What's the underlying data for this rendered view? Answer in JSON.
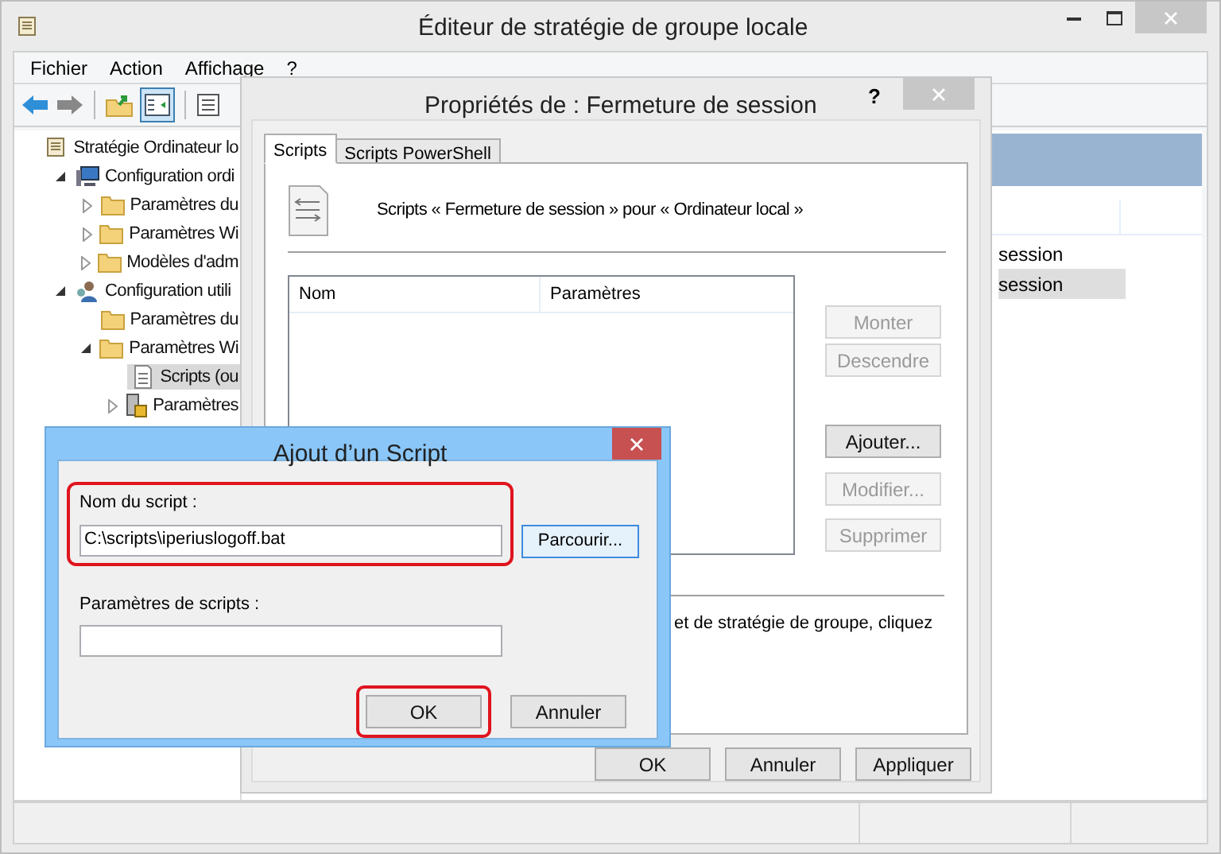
{
  "window": {
    "title": "Éditeur de stratégie de groupe locale"
  },
  "menu": [
    "Fichier",
    "Action",
    "Affichage",
    "?"
  ],
  "tree": [
    {
      "label": "Stratégie Ordinateur lo",
      "kind": "policy",
      "selected": false,
      "children": [
        {
          "label": "Configuration ordi",
          "kind": "computer",
          "expanded": true,
          "selected": false,
          "children": [
            {
              "label": "Paramètres du",
              "kind": "folder",
              "expanded": false,
              "selected": false
            },
            {
              "label": "Paramètres Wi",
              "kind": "folder",
              "expanded": false,
              "selected": false
            },
            {
              "label": "Modèles d'adm",
              "kind": "folder",
              "expanded": false,
              "selected": false
            }
          ]
        },
        {
          "label": "Configuration utili",
          "kind": "user",
          "expanded": true,
          "selected": false,
          "children": [
            {
              "label": "Paramètres du",
              "kind": "folder",
              "selected": false
            },
            {
              "label": "Paramètres Wi",
              "kind": "folder",
              "expanded": true,
              "selected": false,
              "children": [
                {
                  "label": "Scripts (ou",
                  "kind": "script",
                  "selected": true
                },
                {
                  "label": "Paramètres",
                  "kind": "security",
                  "expanded": false,
                  "selected": false
                }
              ]
            }
          ]
        }
      ]
    }
  ],
  "list_items": [
    {
      "label": "session",
      "selected": false
    },
    {
      "label": "session",
      "selected": true
    }
  ],
  "properties": {
    "title": "Propriétés de : Fermeture de session",
    "help": "?",
    "tabs": [
      {
        "label": "Scripts",
        "selected": true
      },
      {
        "label": "Scripts PowerShell",
        "selected": false
      }
    ],
    "heading": "Scripts « Fermeture de session » pour « Ordinateur local »",
    "columns": [
      "Nom",
      "Paramètres"
    ],
    "side_buttons": [
      {
        "label": "Monter",
        "disabled": true
      },
      {
        "label": "Descendre",
        "disabled": true
      },
      {
        "label": "Ajouter...",
        "disabled": false
      },
      {
        "label": "Modifier...",
        "disabled": true
      },
      {
        "label": "Supprimer",
        "disabled": true
      }
    ],
    "note": "et de stratégie de groupe, cliquez",
    "buttons": [
      "OK",
      "Annuler",
      "Appliquer"
    ]
  },
  "add_script": {
    "title": "Ajout d’un Script",
    "fields": [
      {
        "label": "Nom du script :",
        "value": "C:\\scripts\\iperiuslogoff.bat",
        "highlighted": true
      },
      {
        "label": "Paramètres de scripts :",
        "highlighted": false
      }
    ],
    "browse": "Parcourir...",
    "buttons": [
      {
        "label": "OK",
        "highlighted": true
      },
      {
        "label": "Annuler",
        "highlighted": false
      }
    ]
  }
}
